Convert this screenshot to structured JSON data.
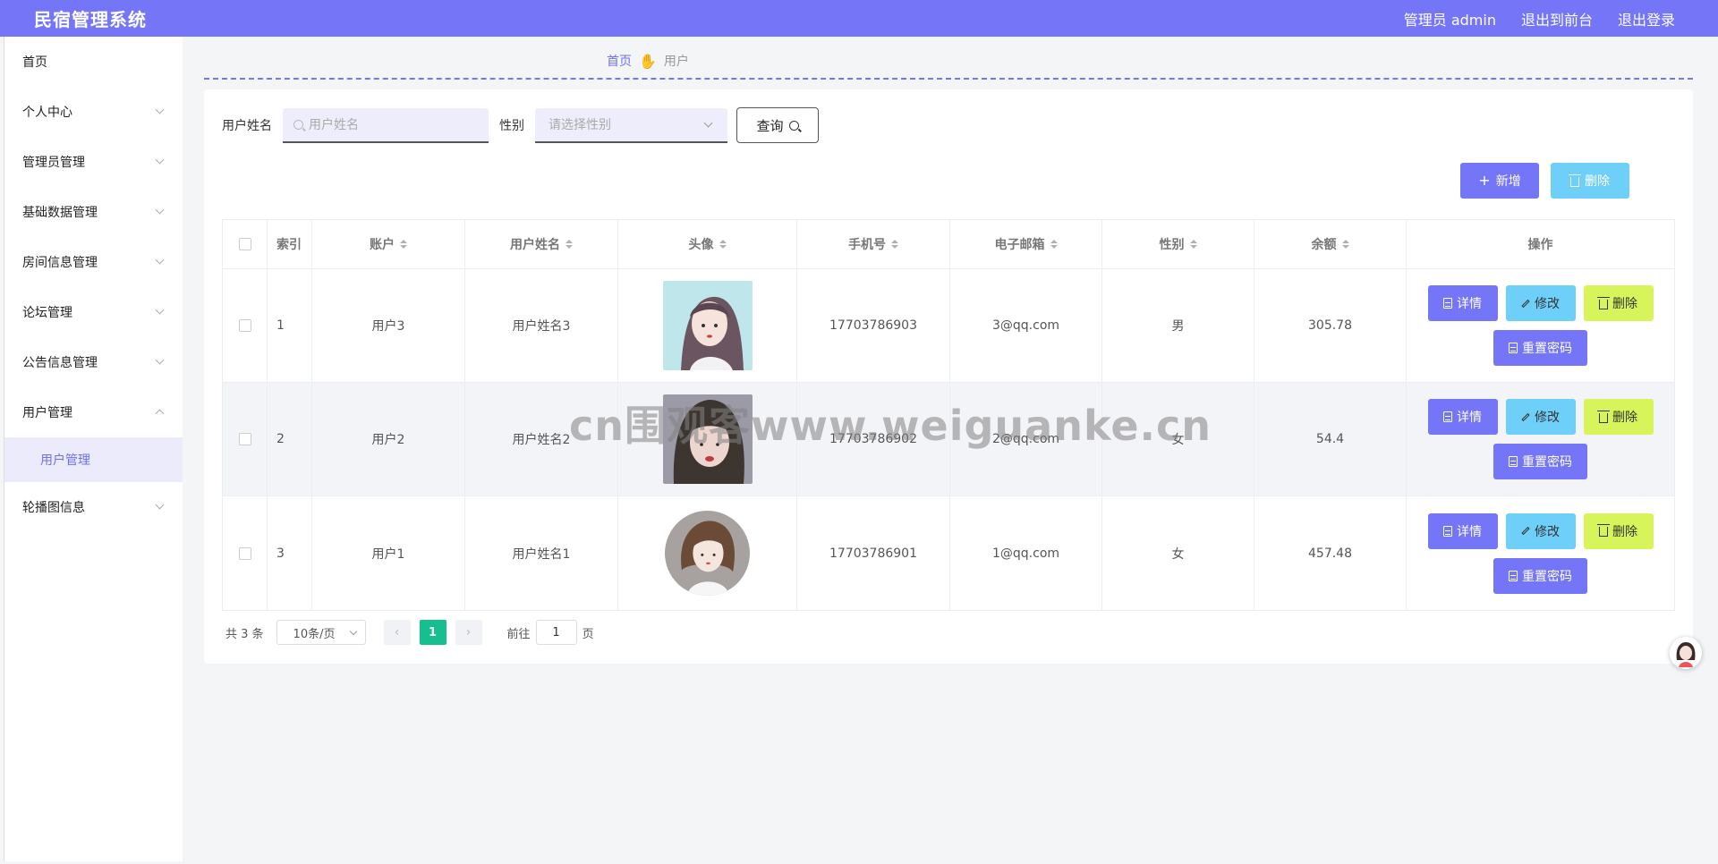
{
  "app": {
    "title": "民宿管理系统",
    "admin": "管理员 admin",
    "to_front": "退出到前台",
    "logout": "退出登录"
  },
  "sidebar": {
    "items": [
      {
        "label": "首页",
        "expandable": false
      },
      {
        "label": "个人中心",
        "expandable": true
      },
      {
        "label": "管理员管理",
        "expandable": true
      },
      {
        "label": "基础数据管理",
        "expandable": true
      },
      {
        "label": "房间信息管理",
        "expandable": true
      },
      {
        "label": "论坛管理",
        "expandable": true
      },
      {
        "label": "公告信息管理",
        "expandable": true
      },
      {
        "label": "用户管理",
        "expandable": true,
        "expanded": true
      },
      {
        "label": "轮播图信息",
        "expandable": true
      }
    ],
    "active_sub": "用户管理"
  },
  "breadcrumb": {
    "home": "首页",
    "current": "用户",
    "separator_icon": "hand-pointer-icon"
  },
  "search": {
    "name_label": "用户姓名",
    "name_placeholder": "用户姓名",
    "sex_label": "性别",
    "sex_placeholder": "请选择性别",
    "query_label": "查询"
  },
  "actions": {
    "add_label": "新增",
    "delete_label": "删除"
  },
  "table": {
    "headers": {
      "index": "索引",
      "account": "账户",
      "name": "用户姓名",
      "avatar": "头像",
      "phone": "手机号",
      "email": "电子邮箱",
      "sex": "性别",
      "balance": "余额",
      "ops": "操作"
    },
    "rows": [
      {
        "index": "1",
        "account": "用户3",
        "name": "用户姓名3",
        "phone": "17703786903",
        "email": "3@qq.com",
        "sex": "男",
        "balance": "305.78"
      },
      {
        "index": "2",
        "account": "用户2",
        "name": "用户姓名2",
        "phone": "17703786902",
        "email": "2@qq.com",
        "sex": "女",
        "balance": "54.4"
      },
      {
        "index": "3",
        "account": "用户1",
        "name": "用户姓名1",
        "phone": "17703786901",
        "email": "1@qq.com",
        "sex": "女",
        "balance": "457.48"
      }
    ],
    "row_ops": {
      "detail": "详情",
      "edit": "修改",
      "delete": "删除",
      "reset": "重置密码"
    }
  },
  "pager": {
    "total": "共 3 条",
    "page_size": "10条/页",
    "current": "1",
    "goto_prefix": "前往",
    "goto_value": "1",
    "goto_suffix": "页"
  },
  "watermark": "cn围观客www.weiguanke.cn",
  "colors": {
    "primary": "#7475f7",
    "cyan": "#6ecff9",
    "lime": "#d7f55a",
    "pager_active": "#16bf8f"
  }
}
